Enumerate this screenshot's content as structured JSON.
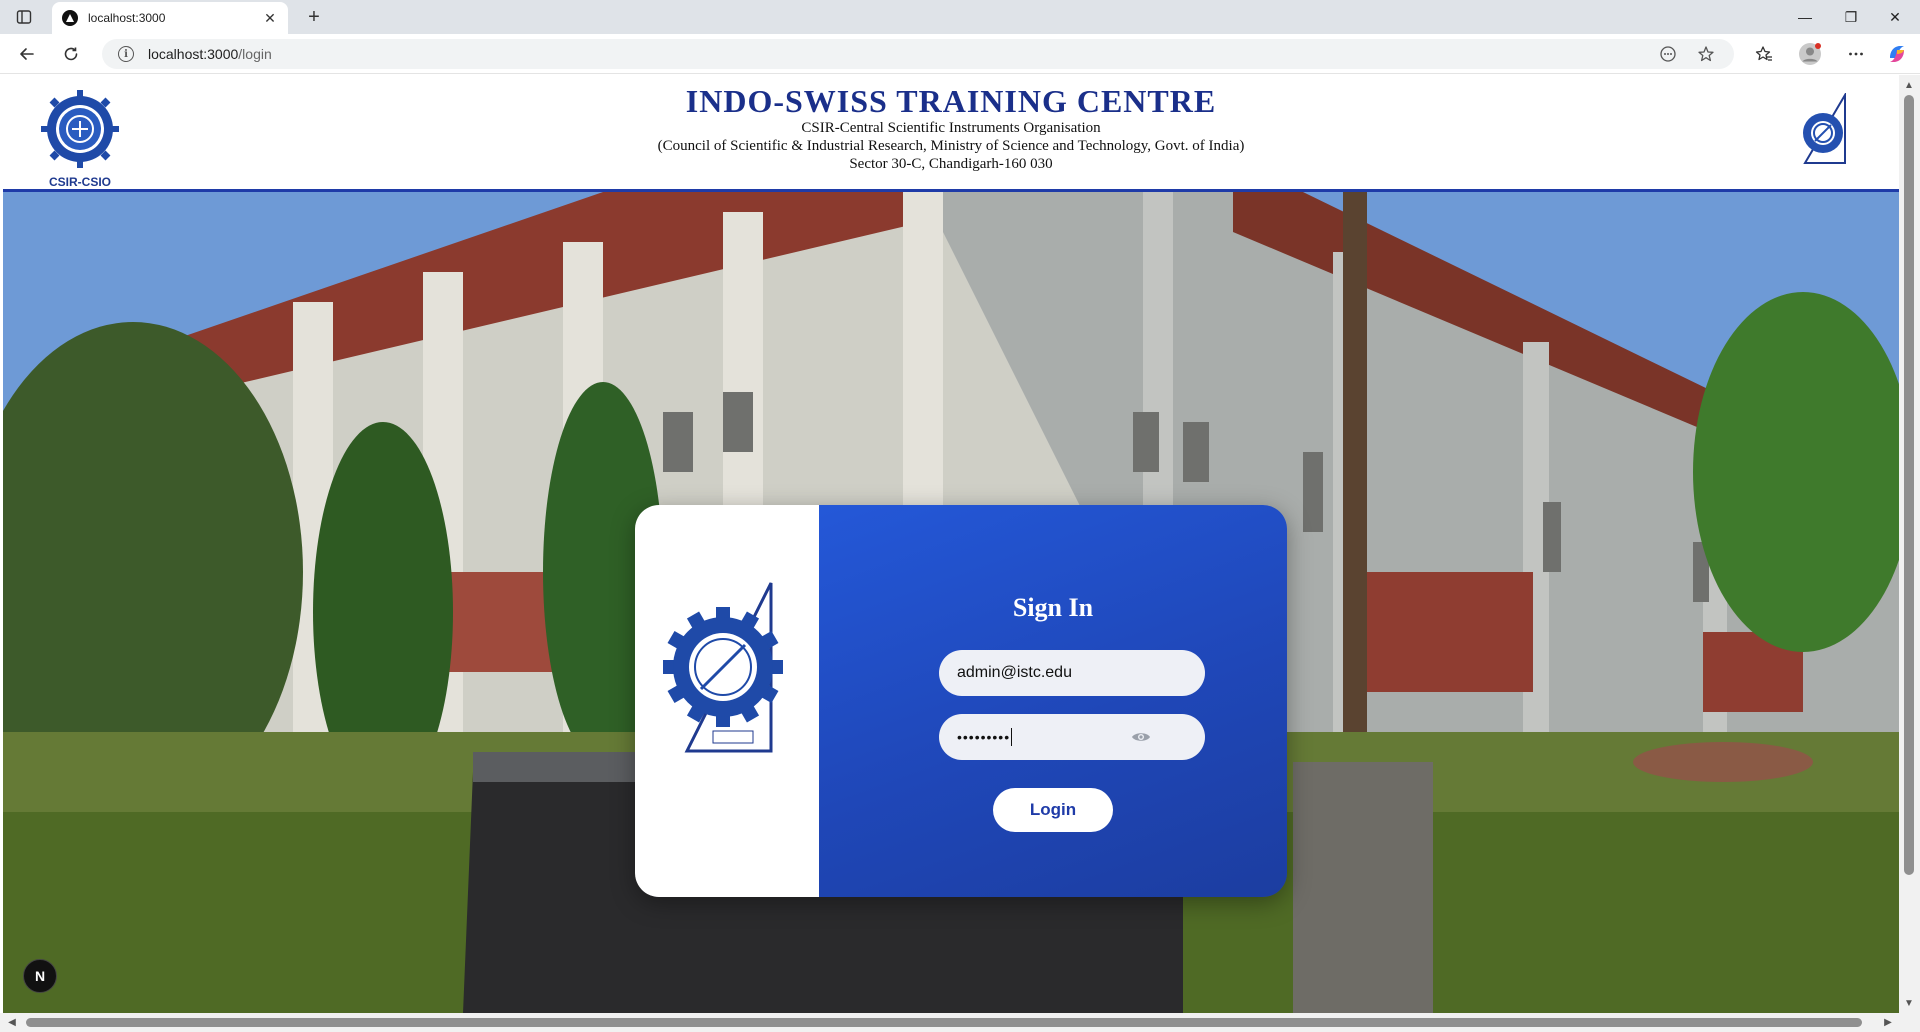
{
  "browser": {
    "tab_title": "localhost:3000",
    "new_tab_label": "+",
    "url_host": "localhost:3000",
    "url_path": "/login",
    "window_controls": {
      "minimize": "—",
      "restore": "❐",
      "close": "✕"
    },
    "icons": [
      "sidebar-icon",
      "favicon-icon",
      "close-icon",
      "back-arrow-icon",
      "reload-icon",
      "info-icon",
      "reader-icon",
      "star-icon",
      "favorites-icon",
      "profile-icon",
      "more-icon",
      "copilot-icon"
    ]
  },
  "header": {
    "title": "INDO-SWISS TRAINING CENTRE",
    "line1": "CSIR-Central Scientific Instruments Organisation",
    "line2": "(Council of Scientific & Industrial Research, Ministry of Science and Technology, Govt. of India)",
    "line3": "Sector 30-C, Chandigarh-160 030",
    "left_logo_caption": "CSIR-CSIO",
    "brand_color": "#1a2f8a",
    "border_color": "#1f3ba8"
  },
  "login": {
    "title": "Sign In",
    "email_value": "admin@istc.edu",
    "password_mask": "•••••••••",
    "login_label": "Login",
    "card_color": "#2458d8"
  },
  "misc": {
    "next_badge": "N"
  }
}
